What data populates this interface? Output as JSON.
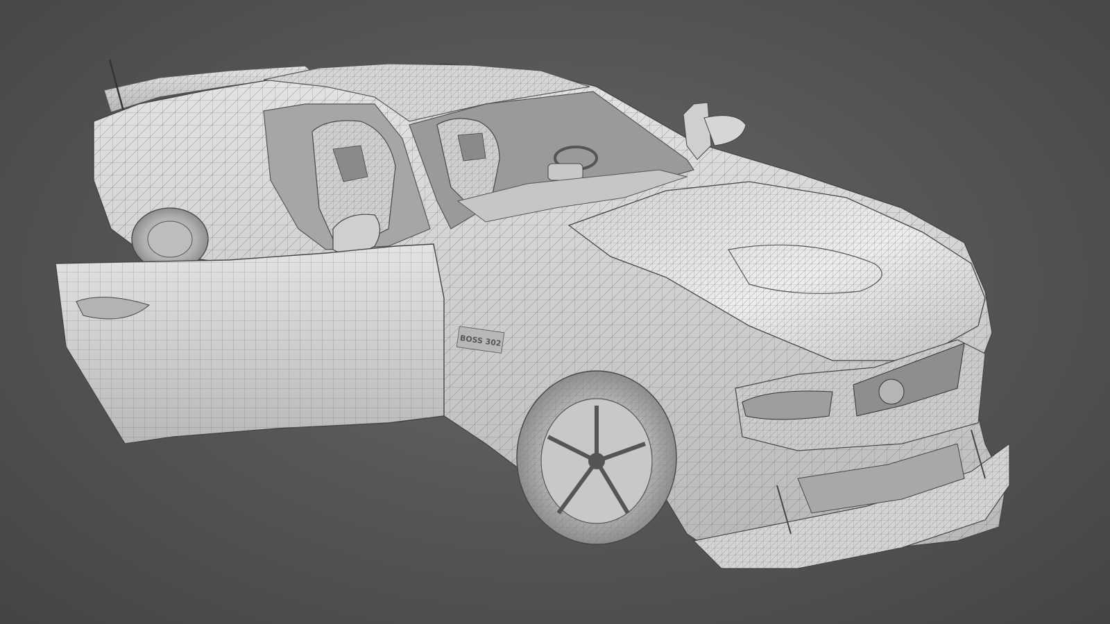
{
  "scene": {
    "background_color": "#575757",
    "render_style": "wireframe-on-shaded",
    "subject": "sports-car-3d-model",
    "mesh_color": "#d9d9d9",
    "wire_color": "#6f6f6f",
    "badge_text": "BOSS 302"
  }
}
